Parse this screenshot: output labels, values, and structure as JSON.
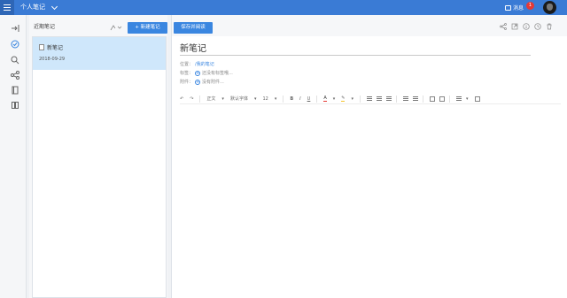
{
  "topbar": {
    "title": "个人笔记",
    "messages_label": "消息",
    "messages_count": "1"
  },
  "notes_panel": {
    "recent_label": "近期笔记",
    "new_note_button": "+ 新建笔记",
    "notes": [
      {
        "title": "新笔记",
        "date": "2018-09-29"
      }
    ]
  },
  "editor": {
    "save_button": "保存并阅读",
    "note_title": "新笔记",
    "location_label": "位置：",
    "location_value": "/我的笔记",
    "tags_label": "标签：",
    "tags_placeholder": "还没有标签哦...",
    "attachments_label": "附件：",
    "attachments_placeholder": "没有附件...",
    "format_bar": {
      "paragraph": "正文",
      "font": "默认字体",
      "font_size": "12",
      "bold": "B",
      "italic": "I",
      "underline": "U",
      "font_color": "A"
    }
  },
  "colors": {
    "accent": "#3a86e0",
    "topbar": "#3a7bd5",
    "selected_note": "#cfe7fb",
    "badge": "#e53935"
  },
  "icons": {
    "rail": [
      "collapse-icon",
      "note-check-icon",
      "search-icon",
      "share-icon",
      "notebook-icon",
      "bookshelf-icon"
    ],
    "editor_toolbar_right": [
      "share-icon",
      "export-icon",
      "info-icon",
      "history-icon",
      "delete-icon"
    ]
  }
}
